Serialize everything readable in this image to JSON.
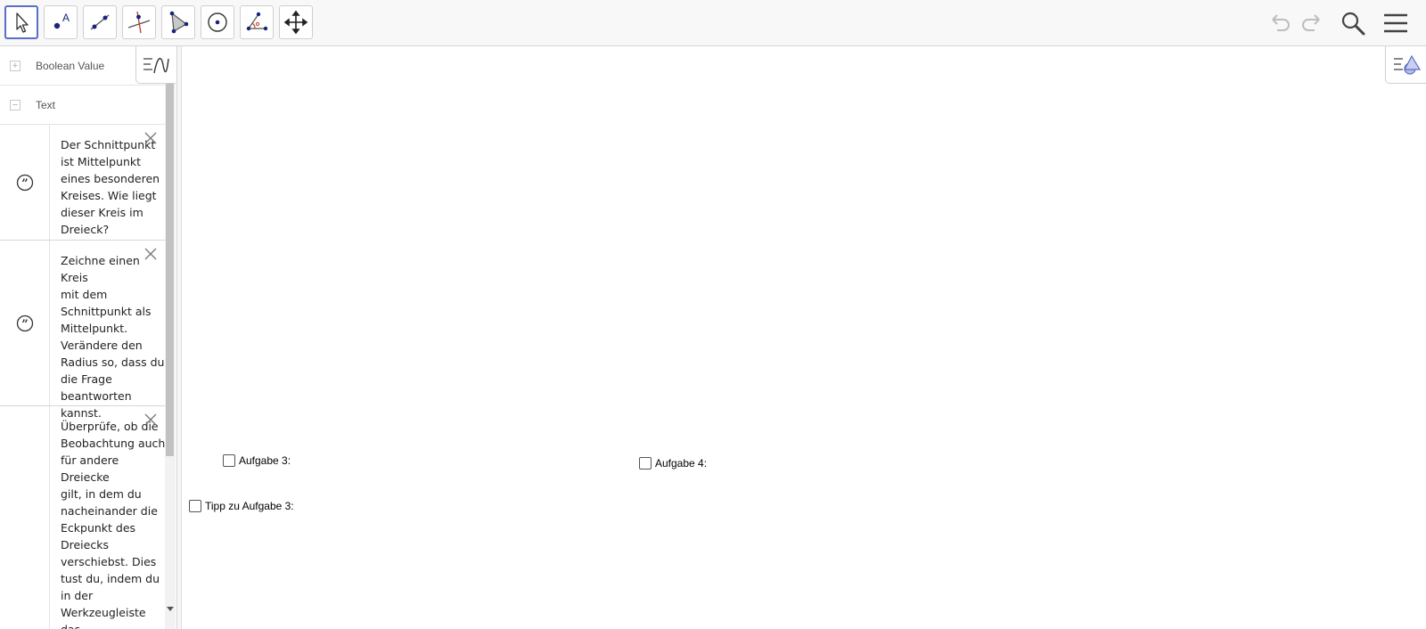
{
  "toolbar": {
    "tools": [
      {
        "name": "move-tool",
        "icon": "arrow-cursor-icon",
        "active": true
      },
      {
        "name": "point-tool",
        "icon": "point-icon",
        "active": false
      },
      {
        "name": "segment-tool",
        "icon": "segment-icon",
        "active": false
      },
      {
        "name": "perpendicular-line-tool",
        "icon": "perpendicular-line-icon",
        "active": false
      },
      {
        "name": "polygon-tool",
        "icon": "polygon-icon",
        "active": false
      },
      {
        "name": "circle-center-point-tool",
        "icon": "circle-icon",
        "active": false
      },
      {
        "name": "angle-tool",
        "icon": "angle-icon",
        "active": false
      },
      {
        "name": "move-graphics-view-tool",
        "icon": "move-arrows-icon",
        "active": false
      }
    ],
    "right_buttons": [
      "undo-icon",
      "redo-icon",
      "search-icon",
      "menu-icon"
    ]
  },
  "algebra": {
    "groups": [
      {
        "label": "Boolean Value",
        "toggle": "+"
      },
      {
        "label": "Text",
        "toggle": "−"
      }
    ],
    "items": [
      {
        "text": "Der Schnittpunkt\nist Mittelpunkt\neines besonderen\nKreises. Wie liegt\ndieser Kreis im\nDreieck?"
      },
      {
        "text": "Zeichne einen Kreis\nmit dem\nSchnittpunkt als\nMittelpunkt.\nVerändere den\nRadius so, dass du\ndie Frage\nbeantworten\nkannst."
      },
      {
        "text": "Überprüfe, ob die\nBeobachtung auch\nfür andere Dreiecke\ngilt, in dem du\nnacheinander die\nEckpunkt des\nDreiecks\nverschiebst. Dies\ntust du, indem du\nin der\nWerkzeugleiste das\nerste Symbol"
      }
    ]
  },
  "graphics": {
    "checkboxes": [
      {
        "label": "Aufgabe 3:",
        "checked": false
      },
      {
        "label": "Aufgabe 4:",
        "checked": false
      },
      {
        "label": "Tipp zu Aufgabe 3:",
        "checked": false
      }
    ]
  },
  "colors": {
    "accent": "#5b6ec7",
    "point": "#1a237e",
    "line": "#666666",
    "perp": "#c0392b"
  }
}
